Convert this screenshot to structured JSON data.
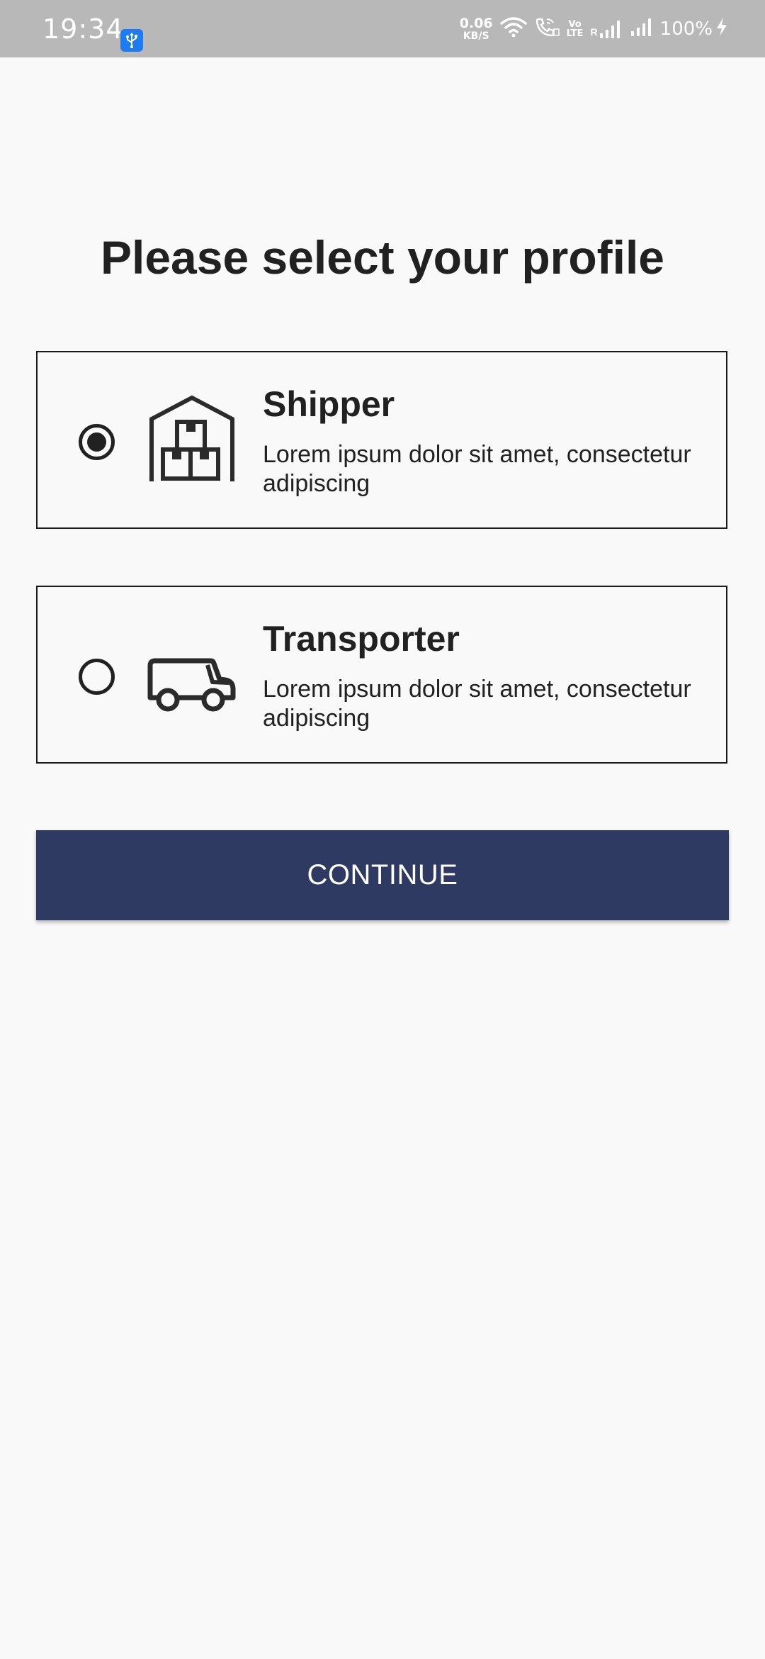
{
  "status_bar": {
    "time": "19:34",
    "net_speed_value": "0.06",
    "net_speed_unit": "KB/S",
    "volte_top": "Vo",
    "volte_bottom": "LTE",
    "roaming_label": "R",
    "battery": "100%",
    "icons": [
      "usb-icon",
      "wifi-icon",
      "wifi-calling-icon",
      "volte-icon",
      "signal-icon",
      "signal-icon",
      "charging-icon"
    ],
    "usb_badge_color": "#1e7cf2"
  },
  "page": {
    "title": "Please select your profile"
  },
  "profiles": [
    {
      "title": "Shipper",
      "description": "Lorem ipsum dolor sit amet, consectetur adipiscing",
      "icon": "warehouse-icon",
      "selected": true
    },
    {
      "title": "Transporter",
      "description": "Lorem ipsum dolor sit amet, consectetur adipiscing",
      "icon": "truck-icon",
      "selected": false
    }
  ],
  "continue_button": {
    "label": "CONTINUE",
    "color": "#2e3a61"
  }
}
